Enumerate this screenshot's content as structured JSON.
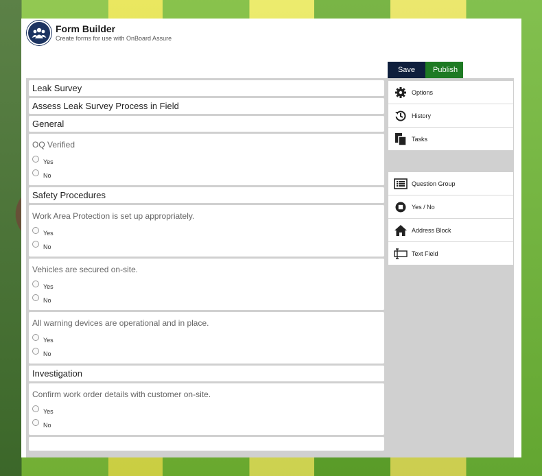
{
  "header": {
    "title": "Form Builder",
    "subtitle": "Create forms for use with OnBoard Assure"
  },
  "toolbar": {
    "save_label": "Save",
    "publish_label": "Publish"
  },
  "form": {
    "form_title": "Leak Survey",
    "form_description": "Assess Leak Survey Process in Field",
    "sections": [
      {
        "title": "General",
        "questions": [
          {
            "text": "OQ Verified",
            "options": [
              "Yes",
              "No"
            ]
          }
        ]
      },
      {
        "title": "Safety Procedures",
        "questions": [
          {
            "text": "Work Area Protection is set up appropriately.",
            "options": [
              "Yes",
              "No"
            ]
          },
          {
            "text": "Vehicles are secured on-site.",
            "options": [
              "Yes",
              "No"
            ]
          },
          {
            "text": "All warning devices are operational and in place.",
            "options": [
              "Yes",
              "No"
            ]
          }
        ]
      },
      {
        "title": "Investigation",
        "questions": [
          {
            "text": "Confirm work order details with customer on-site.",
            "options": [
              "Yes",
              "No"
            ]
          }
        ]
      }
    ]
  },
  "sidebar": {
    "menu": [
      {
        "label": "Options",
        "icon": "gear-icon"
      },
      {
        "label": "History",
        "icon": "history-icon"
      },
      {
        "label": "Tasks",
        "icon": "tasks-icon"
      }
    ],
    "components": [
      {
        "label": "Question Group",
        "icon": "list-icon"
      },
      {
        "label": "Yes / No",
        "icon": "stop-circle-icon"
      },
      {
        "label": "Address Block",
        "icon": "home-icon"
      },
      {
        "label": "Text Field",
        "icon": "text-field-icon"
      }
    ]
  },
  "colors": {
    "logo": "#1d3461",
    "save": "#0f1f3d",
    "publish": "#1e7a23",
    "workarea": "#d0d0d0"
  }
}
